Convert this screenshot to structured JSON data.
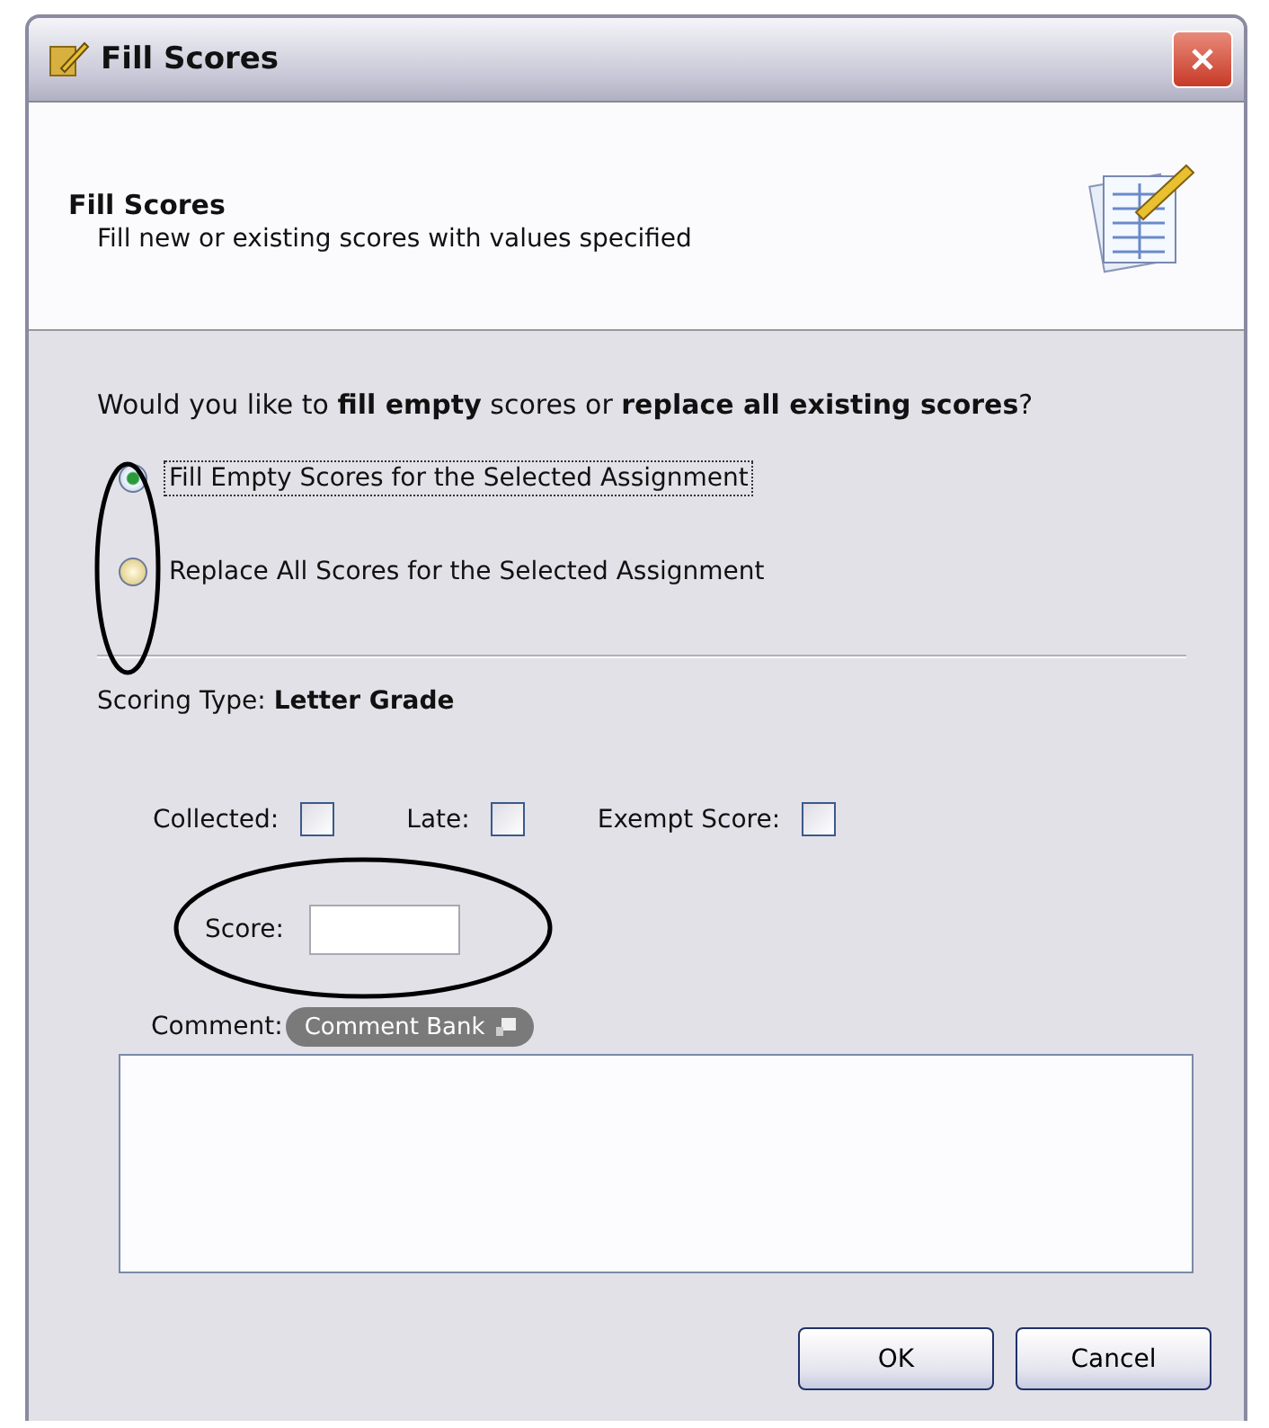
{
  "window": {
    "title": "Fill Scores"
  },
  "header": {
    "title": "Fill Scores",
    "subtitle": "Fill new or existing scores with values specified"
  },
  "question": "Would you like to **fill empty** scores or **replace all existing scores**?",
  "options": [
    {
      "label": "Fill Empty Scores for the Selected Assignment",
      "selected": true,
      "focused": true
    },
    {
      "label": "Replace All Scores for the Selected Assignment",
      "selected": false,
      "focused": false
    }
  ],
  "scoring_type": "Scoring Type: **Letter Grade**",
  "checkboxes": [
    {
      "label": "Collected:",
      "checked": false
    },
    {
      "label": "Late:",
      "checked": false
    },
    {
      "label": "Exempt Score:",
      "checked": false
    }
  ],
  "score": {
    "label": "Score:"
  },
  "comment": {
    "label": "Comment:",
    "bank_button": "Comment Bank"
  },
  "buttons": [
    "OK",
    "Cancel"
  ]
}
